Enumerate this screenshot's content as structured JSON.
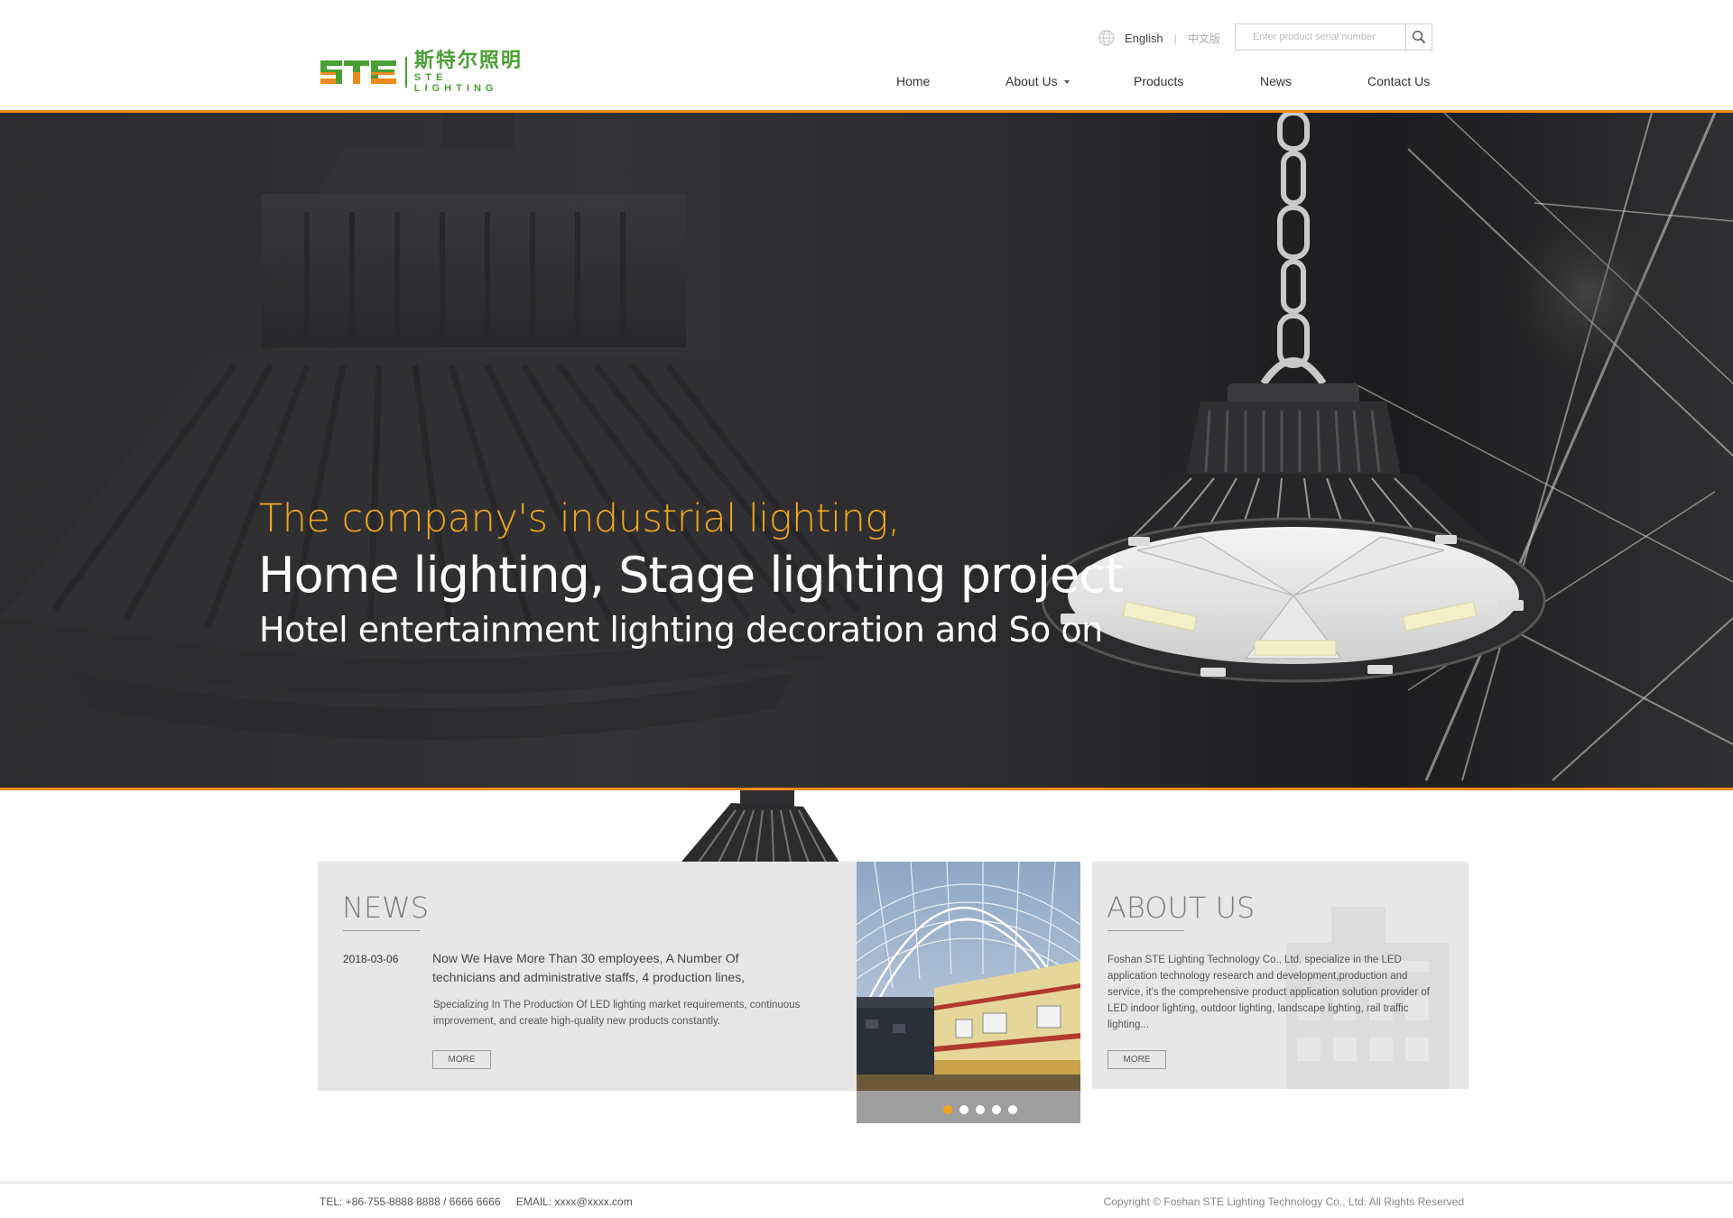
{
  "brand": {
    "logo_mark": "STE",
    "name_cn": "斯特尔照明",
    "name_en": "STE LIGHTING",
    "colors": {
      "green": "#4aa033",
      "orange": "#f08a1c"
    }
  },
  "header": {
    "lang_en": "English",
    "lang_sep": "|",
    "lang_cn": "中文版",
    "search_placeholder": "Enter product serial number",
    "icons": {
      "language": "globe-icon",
      "search": "search-icon"
    }
  },
  "nav": {
    "items": [
      {
        "label": "Home"
      },
      {
        "label": "About Us",
        "dropdown": true
      },
      {
        "label": "Products"
      },
      {
        "label": "News"
      },
      {
        "label": "Contact Us"
      }
    ]
  },
  "hero": {
    "line1": "The company's industrial lighting,",
    "line2": "Home lighting, Stage lighting project",
    "line3": "Hotel entertainment lighting decoration and So on",
    "accent_color": "#f2a71c"
  },
  "news": {
    "title": "NEWS",
    "date": "2018-03-06",
    "headline": "Now We Have More Than 30 employees, A Number Of technicians and administrative staffs, 4 production lines,",
    "description": "Specializing In The Production Of LED lighting market requirements, continuous improvement, and create high-quality new products constantly.",
    "more": "MORE"
  },
  "slider": {
    "dots": 5,
    "active": 0,
    "active_color": "#f5a21c"
  },
  "about": {
    "title": "ABOUT US",
    "text": "Foshan STE Lighting Technology Co., Ltd. specialize in the LED application technology research and development,production and service, it's the comprehensive product application solution provider of LED indoor lighting, outdoor lighting, landscape lighting, rail traffic lighting...",
    "more": "MORE"
  },
  "footer": {
    "tel": "TEL:  +86-755-8888 8888 / 6666 6666",
    "email": "EMAIL: xxxx@xxxx.com",
    "copyright": "Copyright © Foshan STE Lighting Technology Co., Ltd. All Rights Reserved"
  }
}
